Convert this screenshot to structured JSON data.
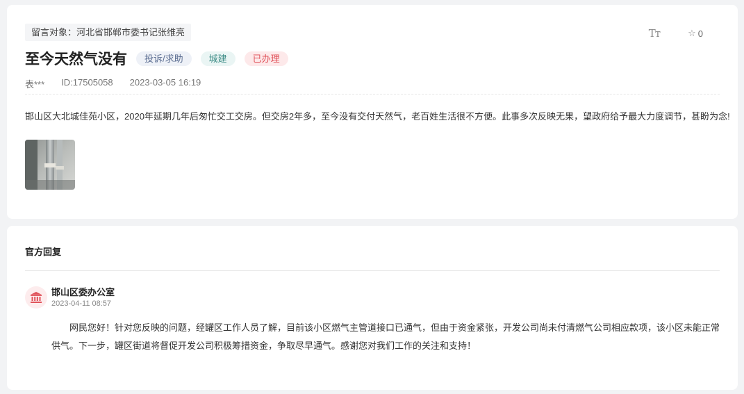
{
  "message": {
    "target_label": "留言对象：河北省邯郸市委书记张维亮",
    "font_size_icon_text": "Tт",
    "favorite_count": "0",
    "title": "至今天然气没有",
    "badges": {
      "type": "投诉/求助",
      "domain": "城建",
      "status": "已办理"
    },
    "author": "表***",
    "id": "ID:17505058",
    "time": "2023-03-05 16:19",
    "content": "邯山区大北城佳苑小区，2020年延期几年后匆忙交工交房。但交房2年多，至今没有交付天然气，老百姓生活很不方便。此事多次反映无果，望政府给予最大力度调节，甚盼为念!"
  },
  "reply": {
    "section_title": "官方回复",
    "department": "邯山区委办公室",
    "time": "2023-04-11 08:57",
    "content": "网民您好！针对您反映的问题，经罐区工作人员了解，目前该小区燃气主管道接口已通气，但由于资金紧张，开发公司尚未付清燃气公司相应款项，该小区未能正常供气。下一步，罐区街道将督促开发公司积极筹措资金，争取尽早通气。感谢您对我们工作的关注和支持！"
  },
  "icons": {
    "favorite": "star-outline-icon",
    "font_size": "font-size-icon",
    "department": "government-building-icon",
    "attachment": "photo-thumbnail"
  },
  "colors": {
    "status_red": "#e0525a",
    "domain_teal": "#3d8c86",
    "type_blue": "#5a6c90"
  }
}
